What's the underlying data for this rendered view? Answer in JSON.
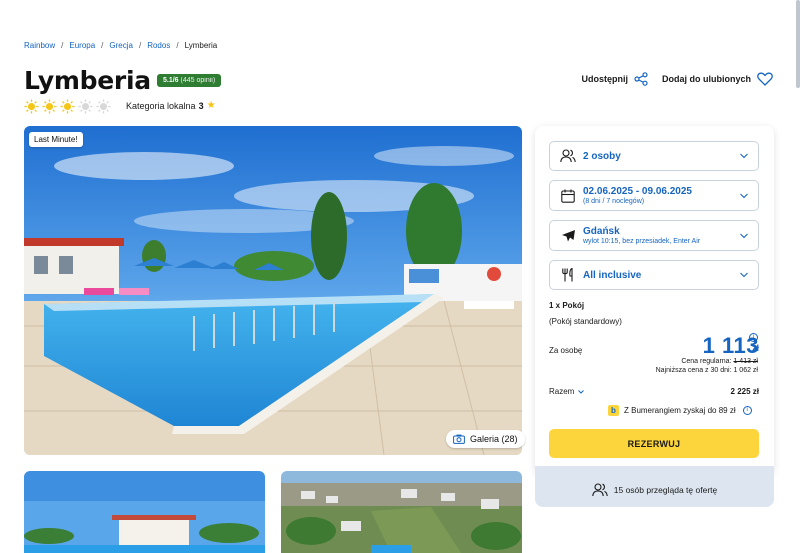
{
  "breadcrumb": [
    "Rainbow",
    "Europa",
    "Grecja",
    "Rodos",
    "Lymberia"
  ],
  "hotel": {
    "name": "Lymberia",
    "rating": "5.1/6",
    "reviews": "(445 opinii)",
    "suns_filled": 3,
    "suns_total": 5,
    "category_label": "Kategoria lokalna",
    "category_value": "3"
  },
  "actions": {
    "share": "Udostępnij",
    "favorite": "Dodaj do ulubionych"
  },
  "hero": {
    "badge": "Last Minute!",
    "gallery": "Galeria (28)"
  },
  "booking": {
    "people": "2 osoby",
    "dates": "02.06.2025 - 09.06.2025",
    "dates_sub": "(8 dni / 7 noclegów)",
    "from_city": "Gdańsk",
    "flight_sub": "wylot 10:15, bez przesiadek, Enter Air",
    "board": "All inclusive",
    "room_count": "1 x Pokój",
    "room_type": "(Pokój standardowy)",
    "per_person_label": "Za osobę",
    "price": "1 113",
    "currency": "zł",
    "regular_label": "Cena regularna:",
    "regular_price": "1 413 zł",
    "lowest_label": "Najniższa cena z 30 dni:",
    "lowest_price": "1 062 zł",
    "total_label": "Razem",
    "total_price": "2 225 zł",
    "bumerang": "Z Bumerangiem zyskaj do 89 zł",
    "reserve": "REZERWUJ",
    "viewers": "15 osób przegląda tę ofertę"
  },
  "colors": {
    "accent": "#1565c0",
    "rating_green": "#2e7d32",
    "cta_yellow": "#fcd53c",
    "sun_yellow": "#f5c518"
  }
}
